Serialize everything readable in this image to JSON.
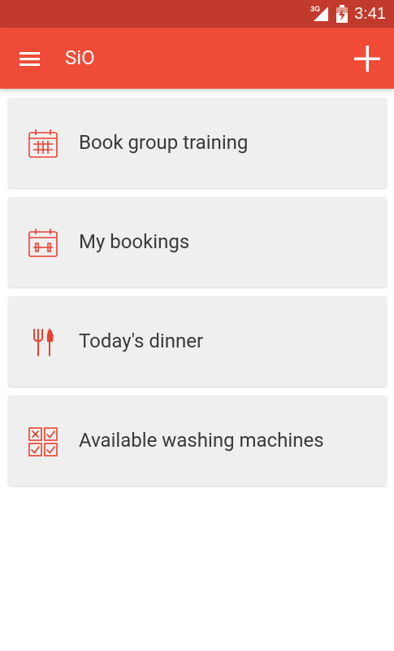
{
  "status_bar": {
    "network_label": "3G",
    "time": "3:41",
    "icons": [
      "signal-icon",
      "battery-icon"
    ]
  },
  "app_bar": {
    "title": "SiO",
    "icons": [
      "menu-icon",
      "add-icon"
    ]
  },
  "menu_items": [
    {
      "label": "Book group training",
      "icon": "calendar-grid-icon"
    },
    {
      "label": "My bookings",
      "icon": "calendar-dumbbell-icon"
    },
    {
      "label": "Today's dinner",
      "icon": "fork-knife-icon"
    },
    {
      "label": "Available washing machines",
      "icon": "checkbox-grid-icon"
    }
  ],
  "colors": {
    "status_bar": "#c23a2b",
    "app_bar": "#f04b37",
    "accent": "#e8412e",
    "card_background": "#efefef",
    "card_text": "#3a3a3a"
  }
}
